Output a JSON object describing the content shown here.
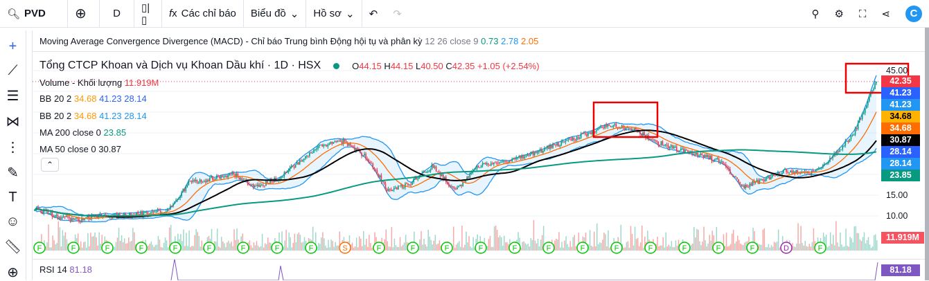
{
  "toolbar": {
    "symbol": "PVD",
    "interval": "D",
    "indicators": "Các chỉ báo",
    "chart": "Biểu đồ",
    "profile": "Hồ sơ"
  },
  "macd": {
    "label": "Moving Average Convergence Divergence (MACD) - Chỉ báo Trung bình Động hội tụ và phân kỳ",
    "params": "12 26 close 9",
    "v1": "0.73",
    "v2": "2.78",
    "v3": "2.05"
  },
  "symbol": {
    "name": "Tổng CTCP Khoan và Dịch vụ Khoan Dầu khí · 1D · HSX",
    "o_label": "O",
    "o": "44.15",
    "h_label": "H",
    "h": "44.15",
    "l_label": "L",
    "l": "40.50",
    "c_label": "C",
    "c": "42.35",
    "change": "+1.05 (+2.54%)"
  },
  "legend": {
    "volume": {
      "label": "Volume - Khối lượng",
      "value": "11.919M"
    },
    "bb1": {
      "label": "BB 20 2",
      "a": "34.68",
      "b": "41.23",
      "c": "28.14"
    },
    "bb2": {
      "label": "BB 20 2",
      "a": "34.68",
      "b": "41.23",
      "c": "28.14"
    },
    "ma200": {
      "label": "MA 200 close 0",
      "value": "23.85"
    },
    "ma50": {
      "label": "MA 50 close 0",
      "value": "30.87"
    }
  },
  "price_axis": {
    "ticks": [
      "45.00",
      "15.00",
      "10.00"
    ],
    "tags": [
      {
        "v": "42.35",
        "c": "#f23645"
      },
      {
        "v": "41.23",
        "c": "#2962ff"
      },
      {
        "v": "41.23",
        "c": "#2196f3"
      },
      {
        "v": "34.68",
        "c": "#ffb300"
      },
      {
        "v": "34.68",
        "c": "#ff6d00"
      },
      {
        "v": "30.87",
        "c": "#000000"
      },
      {
        "v": "28.14",
        "c": "#2962ff"
      },
      {
        "v": "28.14",
        "c": "#2196f3"
      },
      {
        "v": "23.85",
        "c": "#089981"
      }
    ],
    "volume_tag": "11.919M",
    "rsi_tag": "81.18"
  },
  "rsi": {
    "label": "RSI 14",
    "value": "81.18"
  },
  "chart_data": {
    "type": "candlestick",
    "ylim": [
      8,
      46
    ],
    "close_path": [
      12,
      10,
      9,
      10,
      10,
      10.5,
      11,
      18,
      19,
      20,
      17,
      19,
      23,
      27,
      28,
      24,
      16,
      18,
      22,
      16,
      22,
      23,
      24,
      26,
      28,
      30,
      32,
      31,
      28,
      26,
      25,
      23,
      17,
      19,
      21,
      20,
      24,
      30,
      42.35
    ],
    "events": [
      "F",
      "F",
      "F",
      "F",
      "F",
      "F",
      "F",
      "F",
      "F",
      "S",
      "F",
      "F",
      "F",
      "F",
      "F",
      "F",
      "F",
      "F",
      "F",
      "F",
      "F",
      "F",
      "D",
      "F"
    ]
  }
}
